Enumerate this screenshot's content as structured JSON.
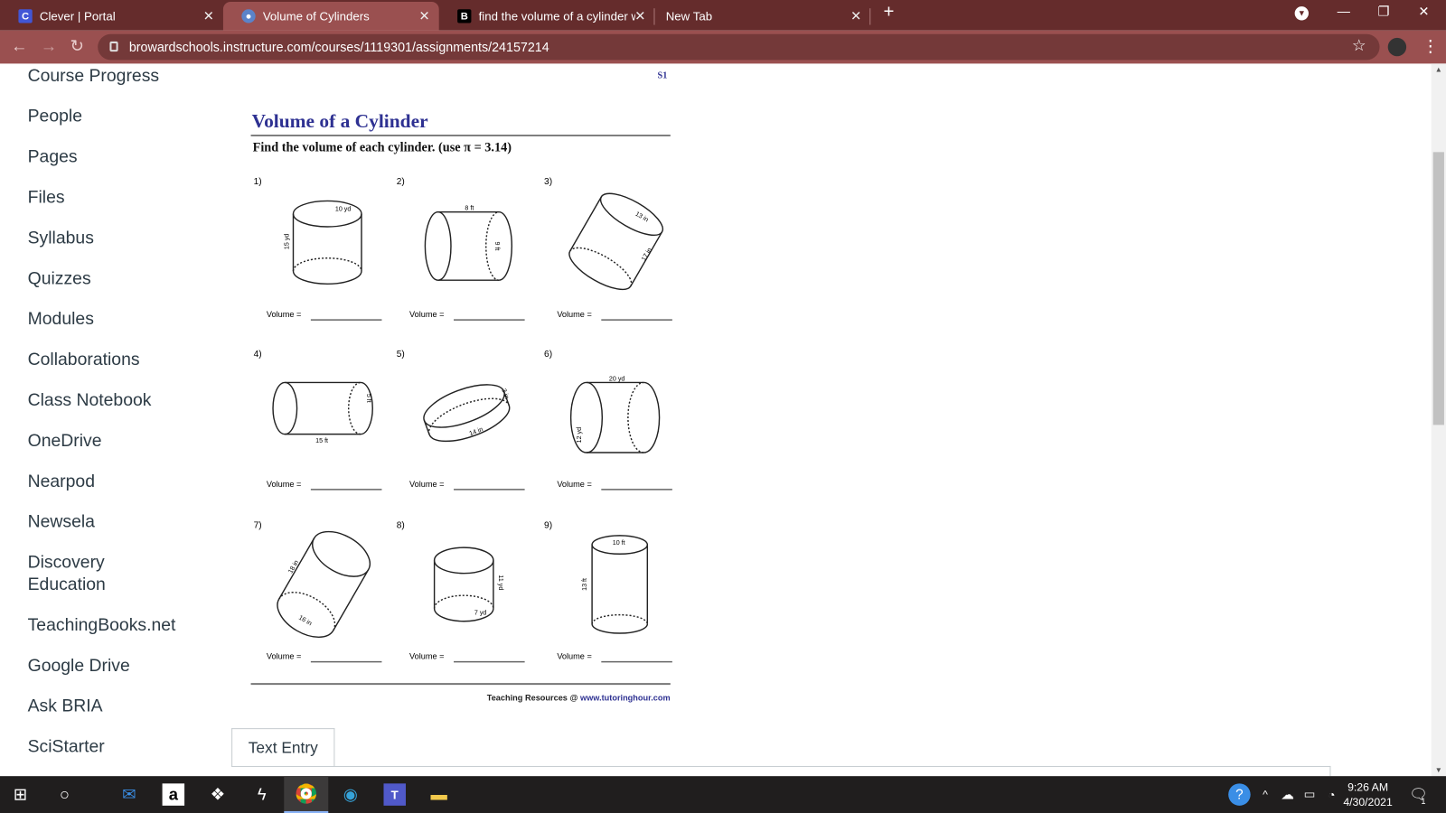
{
  "browser": {
    "tabs": [
      {
        "title": "Clever | Portal",
        "icon": "clever-icon",
        "active": false
      },
      {
        "title": "Volume of Cylinders",
        "icon": "canvas-icon",
        "active": true
      },
      {
        "title": "find the volume of a cylinder witl",
        "icon": "brainly-icon",
        "active": false
      },
      {
        "title": "New Tab",
        "icon": "",
        "active": false
      }
    ],
    "url": "browardschools.instructure.com/courses/1119301/assignments/24157214"
  },
  "sidebar": {
    "items": [
      "Course Progress",
      "People",
      "Pages",
      "Files",
      "Syllabus",
      "Quizzes",
      "Modules",
      "Collaborations",
      "Class Notebook",
      "OneDrive",
      "Nearpod",
      "Newsela",
      "Discovery Education",
      "TeachingBooks.net",
      "Google Drive",
      "Ask BRIA",
      "SciStarter"
    ]
  },
  "worksheet": {
    "page_code": "S1",
    "title": "Volume of a Cylinder",
    "instructions": "Find the volume of each cylinder. (use π = 3.14)",
    "answer_label": "Volume =",
    "problems": [
      {
        "number": "1)",
        "labels": [
          "10 yd",
          "15 yd"
        ]
      },
      {
        "number": "2)",
        "labels": [
          "8 ft",
          "9 ft"
        ]
      },
      {
        "number": "3)",
        "labels": [
          "13 in",
          "17 in"
        ]
      },
      {
        "number": "4)",
        "labels": [
          "15 ft",
          "5 ft"
        ]
      },
      {
        "number": "5)",
        "labels": [
          "14 in",
          "3 in"
        ]
      },
      {
        "number": "6)",
        "labels": [
          "20 yd",
          "12 yd"
        ]
      },
      {
        "number": "7)",
        "labels": [
          "18 in",
          "16 in"
        ]
      },
      {
        "number": "8)",
        "labels": [
          "11 yd",
          "7 yd"
        ]
      },
      {
        "number": "9)",
        "labels": [
          "10 ft",
          "13 ft"
        ]
      }
    ],
    "footer_text": "Teaching Resources @ ",
    "footer_link": "www.tutoringhour.com"
  },
  "submission": {
    "tab_label": "Text Entry"
  },
  "taskbar": {
    "time": "9:26 AM",
    "date": "4/30/2021",
    "notification_count": "1"
  }
}
